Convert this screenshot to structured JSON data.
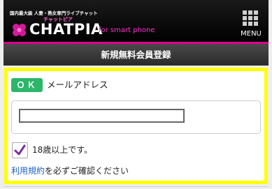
{
  "header": {
    "tagline": "国内最大級 人妻・熟女専門ライブチャット",
    "logo_kana": "チャットピア",
    "logo_text": "CHATPIA",
    "logo_subtext": "for smart phone",
    "menu_label": "MENU",
    "colors": {
      "background": "#000000",
      "accent": "#e00090",
      "tag": "#ff33cc"
    }
  },
  "page": {
    "title": "新規無料会員登録"
  },
  "form": {
    "ok_badge": "ＯＫ",
    "email_label": "メールアドレス",
    "email_value": "",
    "age_checkbox_checked": true,
    "age_label": "18歳以上です。",
    "terms_link": "利用規約",
    "terms_suffix": "を必ずご確認ください",
    "colors": {
      "panel_border": "#ffff00",
      "ok": "#2bb66a",
      "check": "#7b2fa0",
      "link": "#1f5fc8"
    }
  }
}
